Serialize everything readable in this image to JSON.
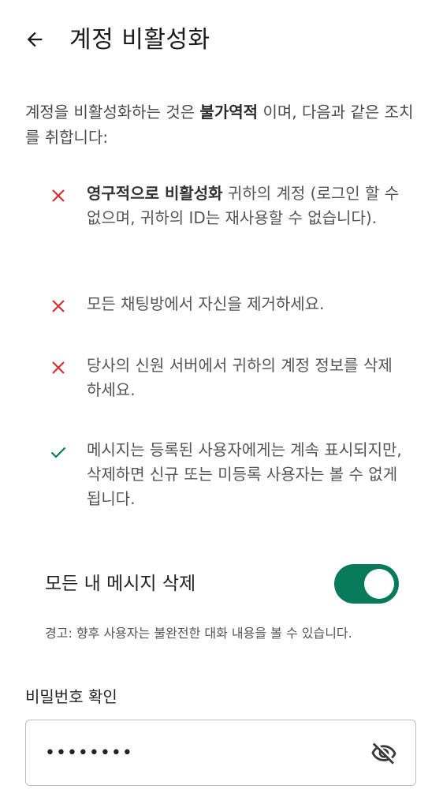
{
  "header": {
    "title": "계정 비활성화",
    "back_icon": "arrow-left-icon"
  },
  "intro": {
    "part1": "계정을 비활성화하는 것은 ",
    "bold": "불가역적",
    "part2": " 이며, 다음과 같은 조치를 취합니다:"
  },
  "consequences": [
    {
      "icon": "x-icon",
      "color": "#d32f2f",
      "bold": "영구적으로 비활성화",
      "text": " 귀하의 계정 (로그인 할 수 없으며, 귀하의 ID는 재사용할 수 없습니다)."
    },
    {
      "icon": "x-icon",
      "color": "#d32f2f",
      "bold": "",
      "text": "모든 채팅방에서 자신을 제거하세요."
    },
    {
      "icon": "x-icon",
      "color": "#d32f2f",
      "bold": "",
      "text": "당사의 신원 서버에서 귀하의 계정 정보를 삭제하세요."
    },
    {
      "icon": "check-icon",
      "color": "#067a5b",
      "bold": "",
      "text": "메시지는 등록된 사용자에게는 계속 표시되지만, 삭제하면 신규 또는 미등록 사용자는 볼 수 없게 됩니다."
    }
  ],
  "delete_messages": {
    "label": "모든 내 메시지 삭제",
    "enabled": true,
    "accent": "#067a5b"
  },
  "warning": "경고: 향후 사용자는 불완전한 대화 내용을 볼 수 있습니다.",
  "password": {
    "label": "비밀번호 확인",
    "value": "••••••••",
    "toggle_icon": "eye-off-icon"
  }
}
